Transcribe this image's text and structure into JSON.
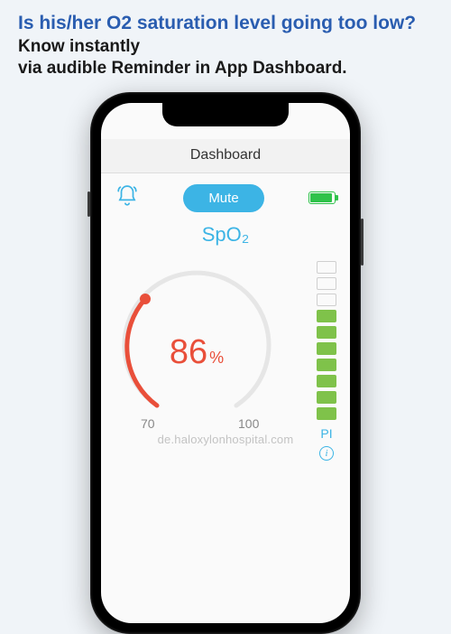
{
  "promo": {
    "headline": "Is his/her O2 saturation level going too low?",
    "subline": "Know instantly\nvia audible Reminder in App Dashboard."
  },
  "app": {
    "title": "Dashboard",
    "mute_label": "Mute",
    "measure_label": "SpO₂",
    "gauge": {
      "value": 86,
      "unit": "%",
      "min_tick": "70",
      "max_tick": "100",
      "scale_min": 70,
      "scale_max": 100
    },
    "pi": {
      "label": "PI",
      "bars_total": 10,
      "bars_filled": 7
    },
    "battery_fill_pct": 85
  },
  "colors": {
    "accent": "#3cb4e5",
    "value": "#e94f3a",
    "ok": "#7fc24a",
    "battery": "#2fc24a",
    "headline": "#2a5db0"
  },
  "watermark": "de.haloxylonhospital.com"
}
